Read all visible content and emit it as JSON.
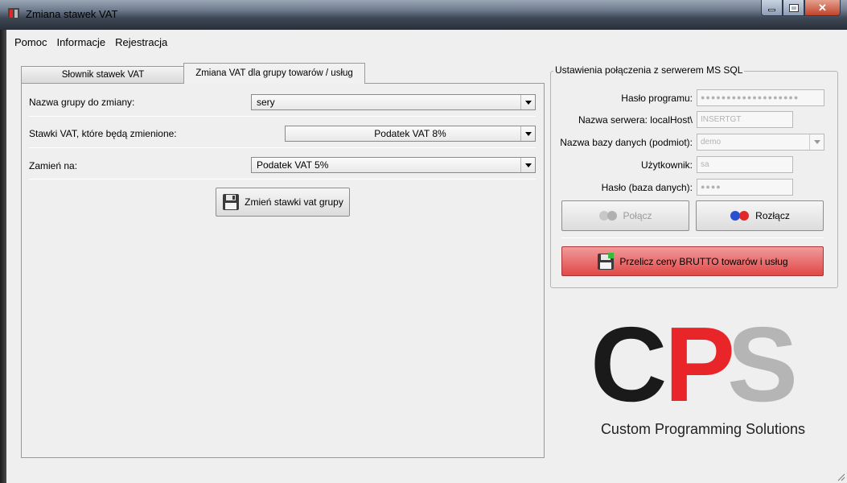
{
  "window": {
    "title": "Zmiana stawek VAT"
  },
  "menu": [
    "Pomoc",
    "Informacje",
    "Rejestracja"
  ],
  "tabs": [
    "Słownik stawek VAT",
    "Zmiana VAT dla grupy towarów / usług"
  ],
  "form": {
    "group_label": "Nazwa grupy do zmiany:",
    "group_value": "sery",
    "rates_label": "Stawki VAT, które będą zmienione:",
    "rates_value": "Podatek VAT 8%",
    "replace_label": "Zamień na:",
    "replace_value": "Podatek VAT 5%",
    "change_button": "Zmień stawki vat grupy"
  },
  "server": {
    "title": "Ustawienia połączenia z serwerem MS SQL",
    "program_password_label": "Hasło programu:",
    "server_name_label": "Nazwa serwera: localHost\\",
    "server_name_value": "INSERTGT",
    "database_label": "Nazwa bazy danych (podmiot):",
    "database_value": "demo",
    "user_label": "Użytkownik:",
    "user_value": "sa",
    "db_password_label": "Hasło (baza danych):",
    "connect_button": "Połącz",
    "disconnect_button": "Rozłącz",
    "recalc_button": "Przelicz ceny BRUTTO towarów i usług"
  },
  "logo": {
    "letters": [
      "C",
      "P",
      "S"
    ],
    "tagline": "Custom Programming Solutions",
    "colors": {
      "c": "#1a1a1a",
      "p": "#e8262a",
      "s": "#b5b5b5"
    }
  },
  "colors": {
    "recalc_button": "#e55050",
    "titlebar": "#3e4856"
  }
}
